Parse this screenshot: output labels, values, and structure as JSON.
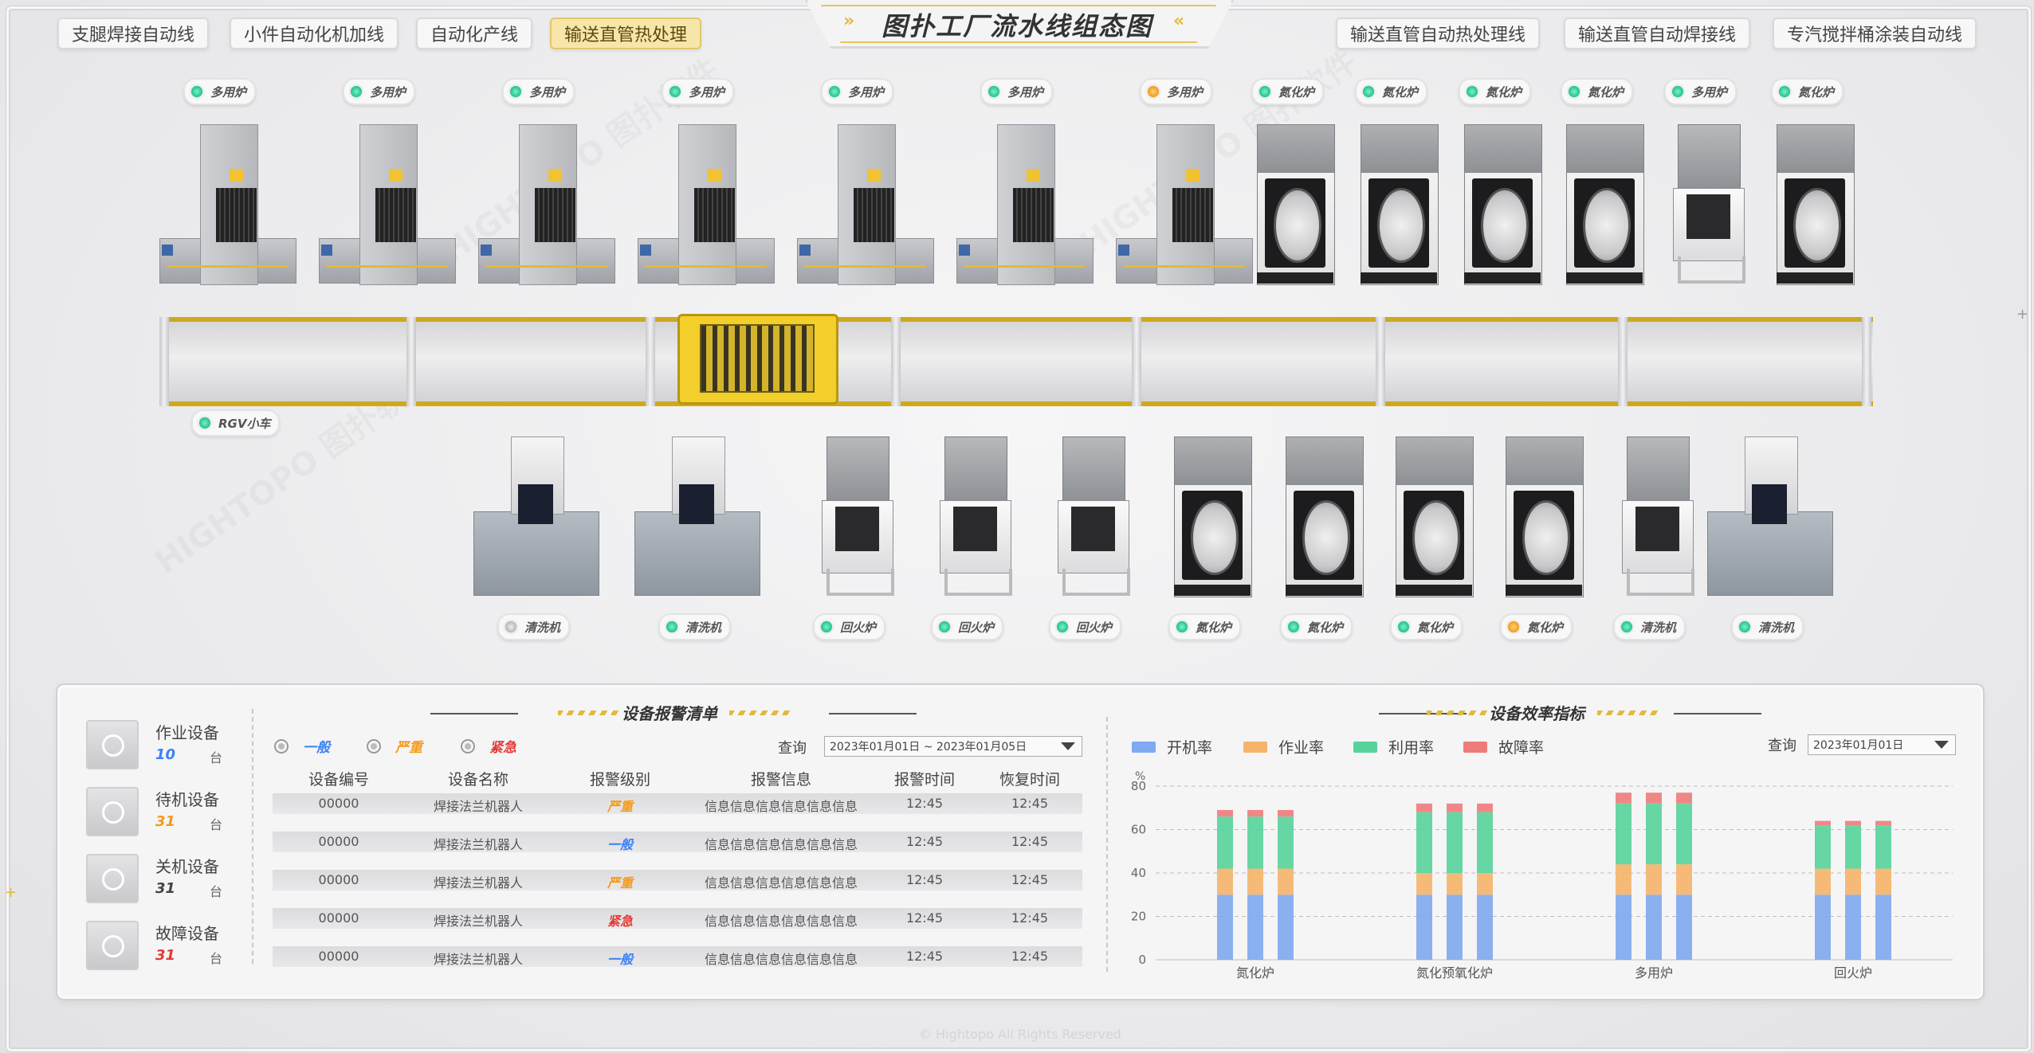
{
  "title": "图扑工厂流水线组态图",
  "title_arrows": {
    "left": "»",
    "right": "«"
  },
  "tabs_left": [
    "支腿焊接自动线",
    "小件自动化机加线",
    "自动化产线",
    "输送直管热处理"
  ],
  "tabs_right": [
    "输送直管自动热处理线",
    "输送直管自动焊接线",
    "专汽搅拌桶涂装自动线"
  ],
  "active_tab": "输送直管热处理",
  "top_machines": [
    {
      "label": "多用炉",
      "status": "green",
      "kind": "furnace"
    },
    {
      "label": "多用炉",
      "status": "green",
      "kind": "furnace"
    },
    {
      "label": "多用炉",
      "status": "green",
      "kind": "furnace"
    },
    {
      "label": "多用炉",
      "status": "green",
      "kind": "furnace"
    },
    {
      "label": "多用炉",
      "status": "green",
      "kind": "furnace"
    },
    {
      "label": "多用炉",
      "status": "green",
      "kind": "furnace"
    },
    {
      "label": "多用炉",
      "status": "orange",
      "kind": "furnace"
    },
    {
      "label": "氮化炉",
      "status": "green",
      "kind": "nitride"
    },
    {
      "label": "氮化炉",
      "status": "green",
      "kind": "nitride"
    },
    {
      "label": "氮化炉",
      "status": "green",
      "kind": "nitride"
    },
    {
      "label": "氮化炉",
      "status": "green",
      "kind": "nitride"
    },
    {
      "label": "多用炉",
      "status": "green",
      "kind": "tempering"
    },
    {
      "label": "氮化炉",
      "status": "green",
      "kind": "nitride"
    }
  ],
  "rgv_label": "RGV小车",
  "bottom_machines": [
    {
      "label": "清洗机",
      "status": "gray",
      "kind": "washer"
    },
    {
      "label": "清洗机",
      "status": "green",
      "kind": "washer"
    },
    {
      "label": "回火炉",
      "status": "green",
      "kind": "tempering"
    },
    {
      "label": "回火炉",
      "status": "green",
      "kind": "tempering"
    },
    {
      "label": "回火炉",
      "status": "green",
      "kind": "tempering"
    },
    {
      "label": "氮化炉",
      "status": "green",
      "kind": "nitride"
    },
    {
      "label": "氮化炉",
      "status": "green",
      "kind": "nitride"
    },
    {
      "label": "氮化炉",
      "status": "green",
      "kind": "nitride"
    },
    {
      "label": "氮化炉",
      "status": "orange",
      "kind": "nitride"
    },
    {
      "label": "清洗机",
      "status": "green",
      "kind": "tempering"
    },
    {
      "label": "清洗机",
      "status": "green",
      "kind": "washer"
    }
  ],
  "stats": [
    {
      "label": "作业设备",
      "value": "10",
      "unit": "台",
      "color": "#3b82f6"
    },
    {
      "label": "待机设备",
      "value": "31",
      "unit": "台",
      "color": "#f39a1a"
    },
    {
      "label": "关机设备",
      "value": "31",
      "unit": "台",
      "color": "#444444"
    },
    {
      "label": "故障设备",
      "value": "31",
      "unit": "台",
      "color": "#e53935"
    }
  ],
  "alarm": {
    "title": "设备报警清单",
    "filters": [
      {
        "label": "一般",
        "color": "#3b82f6"
      },
      {
        "label": "严重",
        "color": "#f39a1a"
      },
      {
        "label": "紧急",
        "color": "#e53935"
      }
    ],
    "query_label": "查询",
    "date_range": "2023年01月01日 ~ 2023年01月05日",
    "headers": [
      "设备编号",
      "设备名称",
      "报警级别",
      "报警信息",
      "报警时间",
      "恢复时间"
    ],
    "rows": [
      {
        "id": "00000",
        "name": "焊接法兰机器人",
        "level": "严重",
        "level_color": "#f39a1a",
        "info": "信息信息信息信息信息信息",
        "time": "12:45",
        "recover": "12:45"
      },
      {
        "id": "00000",
        "name": "焊接法兰机器人",
        "level": "一般",
        "level_color": "#3b82f6",
        "info": "信息信息信息信息信息信息",
        "time": "12:45",
        "recover": "12:45"
      },
      {
        "id": "00000",
        "name": "焊接法兰机器人",
        "level": "严重",
        "level_color": "#f39a1a",
        "info": "信息信息信息信息信息信息",
        "time": "12:45",
        "recover": "12:45"
      },
      {
        "id": "00000",
        "name": "焊接法兰机器人",
        "level": "紧急",
        "level_color": "#e53935",
        "info": "信息信息信息信息信息信息",
        "time": "12:45",
        "recover": "12:45"
      },
      {
        "id": "00000",
        "name": "焊接法兰机器人",
        "level": "一般",
        "level_color": "#3b82f6",
        "info": "信息信息信息信息信息信息",
        "time": "12:45",
        "recover": "12:45"
      }
    ]
  },
  "efficiency": {
    "title": "设备效率指标",
    "query_label": "查询",
    "date": "2023年01月01日"
  },
  "chart_data": {
    "type": "bar",
    "stacked": true,
    "ylabel": "%",
    "ylim": [
      0,
      80
    ],
    "yticks": [
      0,
      20,
      40,
      60,
      80
    ],
    "grid": true,
    "legend_position": "top-left",
    "groups": [
      "氮化炉",
      "氮化预氧化炉",
      "多用炉",
      "回火炉"
    ],
    "bars_per_group": 3,
    "series": [
      {
        "name": "开机率",
        "color": "#7fa9f0",
        "values": [
          30,
          30,
          30,
          30,
          30,
          30,
          30,
          30,
          30,
          30,
          30,
          30
        ]
      },
      {
        "name": "作业率",
        "color": "#f6b46a",
        "values": [
          12,
          12,
          12,
          10,
          10,
          10,
          14,
          14,
          14,
          12,
          12,
          12
        ]
      },
      {
        "name": "利用率",
        "color": "#56d39b",
        "values": [
          24,
          24,
          24,
          28,
          28,
          28,
          28,
          28,
          28,
          20,
          20,
          20
        ]
      },
      {
        "name": "故障率",
        "color": "#f07b7b",
        "values": [
          3,
          3,
          3,
          4,
          4,
          4,
          5,
          5,
          5,
          2,
          2,
          2
        ]
      }
    ]
  },
  "footer": "© Hightopo All Rights Reserved"
}
